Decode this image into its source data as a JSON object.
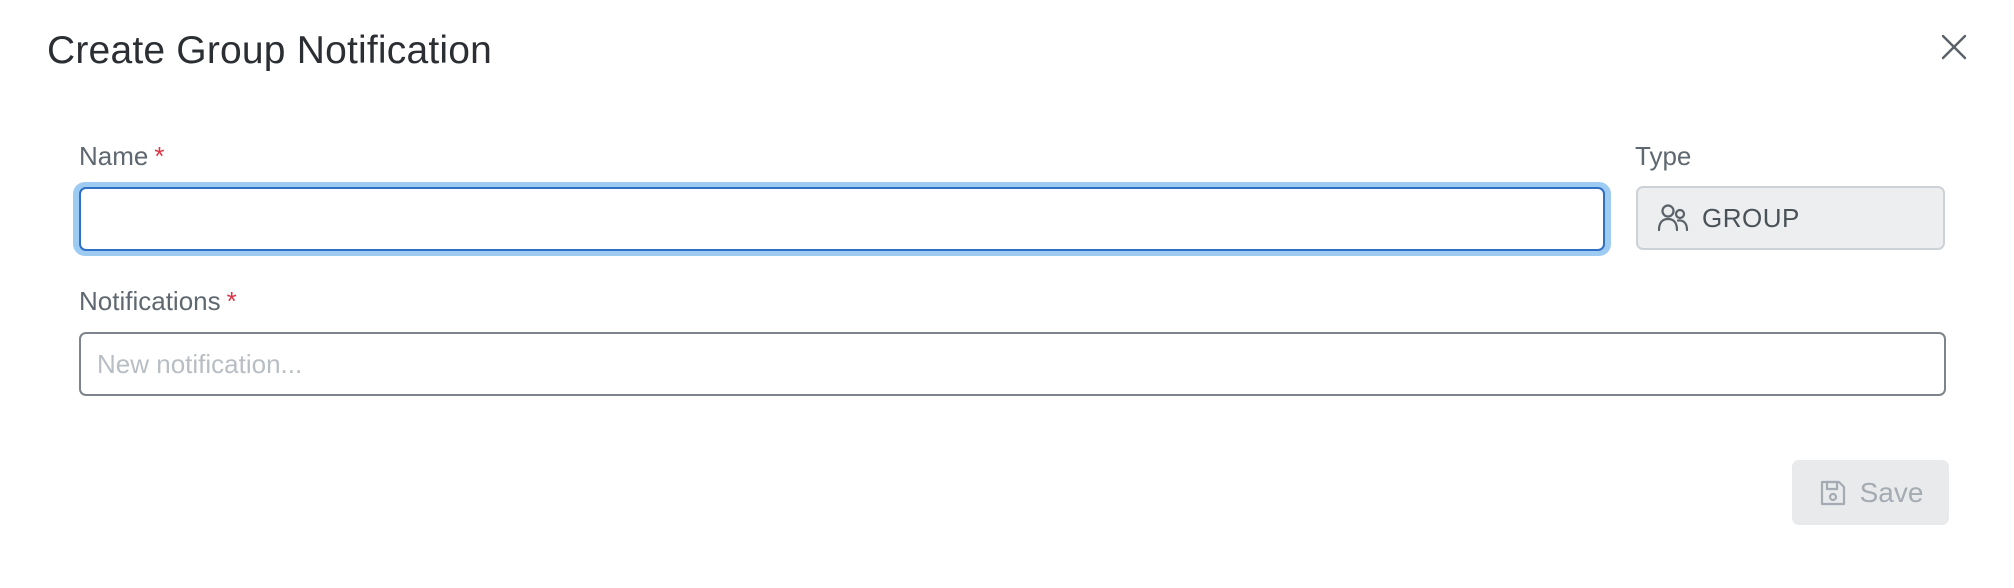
{
  "dialog": {
    "title": "Create Group Notification",
    "close_icon": "close-icon"
  },
  "form": {
    "name": {
      "label": "Name",
      "required_marker": "*",
      "value": "",
      "focused": true
    },
    "type": {
      "label": "Type",
      "icon": "group-users-icon",
      "value": "GROUP"
    },
    "notifications": {
      "label": "Notifications",
      "required_marker": "*",
      "placeholder": "New notification...",
      "value": ""
    }
  },
  "actions": {
    "save_label": "Save",
    "save_icon": "save-icon",
    "save_disabled": true
  },
  "colors": {
    "focus_ring": "#9ecbf2",
    "focus_border": "#2f6fc4",
    "required": "#dc3545",
    "disabled_button_bg": "#e8eaec",
    "disabled_text": "#a4abb2"
  }
}
